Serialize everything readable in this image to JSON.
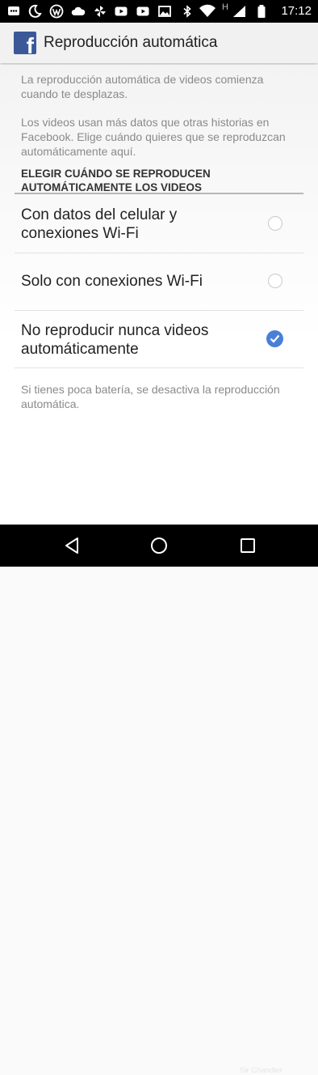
{
  "status_bar": {
    "time": "17:12",
    "icons": [
      "message-icon",
      "moon-icon",
      "wordpress-icon",
      "cloud-icon",
      "pinwheel-icon",
      "youtube-icon",
      "youtube-icon",
      "image-icon",
      "bluetooth-icon",
      "wifi-icon",
      "signal-icon",
      "battery-icon"
    ],
    "network_letter": "H"
  },
  "app_bar": {
    "logo_letter": "f",
    "title": "Reproducción automática"
  },
  "intro": {
    "line1": "La reproducción automática de videos comienza cuando te desplazas.",
    "line2": "Los videos usan más datos que otras historias en Facebook. Elige cuándo quieres que se reproduzcan automáticamente aquí."
  },
  "section": {
    "header": "ELEGIR CUÁNDO SE REPRODUCEN AUTOMÁTICAMENTE LOS VIDEOS"
  },
  "options": [
    {
      "label": "Con datos del celular y conexiones Wi-Fi",
      "selected": false
    },
    {
      "label": "Solo con conexiones Wi-Fi",
      "selected": false
    },
    {
      "label": "No reproducir nunca videos automáticamente",
      "selected": true
    }
  ],
  "footer_note": "Si tienes poca batería, se desactiva la reproducción automática.",
  "nav_bar": {
    "buttons": [
      "back-icon",
      "home-icon",
      "recents-icon"
    ],
    "watermark": "Sir Chandler"
  },
  "colors": {
    "accent": "#4a7fd8",
    "facebook_blue": "#3b5998",
    "status_bar": "#000000"
  }
}
